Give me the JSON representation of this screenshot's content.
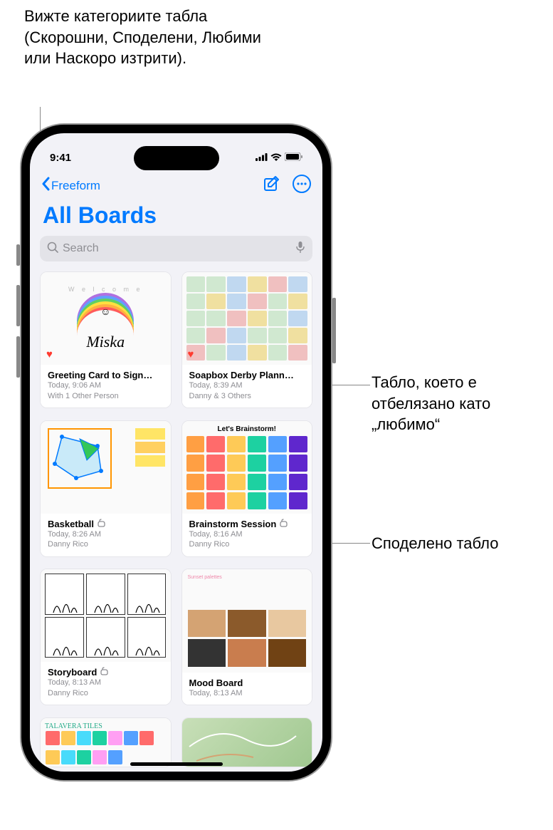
{
  "callouts": {
    "top": "Вижте категориите табла (Скорошни, Споделени, Любими или Наскоро изтрити).",
    "favorite": "Табло, което е отбелязано като „любимо“",
    "shared": "Споделено табло"
  },
  "status": {
    "time": "9:41"
  },
  "nav": {
    "back": "Freeform"
  },
  "title": "All Boards",
  "search": {
    "placeholder": "Search"
  },
  "brainstorm_thumb_title": "Let's Brainstorm!",
  "boards": [
    {
      "title": "Greeting Card to Sign…",
      "time": "Today, 9:06 AM",
      "sub": "With 1 Other Person",
      "favorite": true,
      "shared": false,
      "thumb": "rainbow",
      "script": "Miska"
    },
    {
      "title": "Soapbox Derby Plann…",
      "time": "Today, 8:39 AM",
      "sub": "Danny & 3 Others",
      "favorite": true,
      "shared": false,
      "thumb": "collage"
    },
    {
      "title": "Basketball",
      "time": "Today, 8:26 AM",
      "sub": "Danny Rico",
      "favorite": false,
      "shared": true,
      "thumb": "graph"
    },
    {
      "title": "Brainstorm Session",
      "time": "Today, 8:16 AM",
      "sub": "Danny Rico",
      "favorite": false,
      "shared": true,
      "thumb": "brainstorm"
    },
    {
      "title": "Storyboard",
      "time": "Today, 8:13 AM",
      "sub": "Danny Rico",
      "favorite": false,
      "shared": true,
      "thumb": "story"
    },
    {
      "title": "Mood Board",
      "time": "Today, 8:13 AM",
      "sub": "",
      "favorite": false,
      "shared": false,
      "thumb": "mood"
    },
    {
      "title": "",
      "time": "",
      "sub": "",
      "favorite": false,
      "shared": false,
      "thumb": "tiles",
      "tiles_label": "TALAVERA TILES",
      "partial": true
    },
    {
      "title": "",
      "time": "",
      "sub": "",
      "favorite": false,
      "shared": false,
      "thumb": "map",
      "partial": true
    }
  ]
}
